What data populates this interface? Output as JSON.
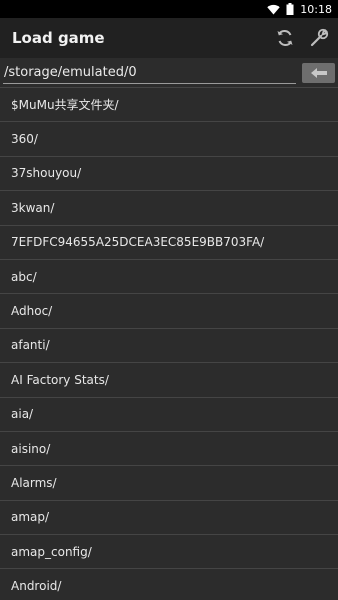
{
  "status_bar": {
    "time": "10:18"
  },
  "app_bar": {
    "title": "Load game"
  },
  "path_field": {
    "value": "/storage/emulated/0"
  },
  "files": [
    "$MuMu共享文件夹/",
    "360/",
    "37shouyou/",
    "3kwan/",
    "7EFDFC94655A25DCEA3EC85E9BB703FA/",
    "abc/",
    "Adhoc/",
    "afanti/",
    "AI Factory Stats/",
    "aia/",
    "aisino/",
    "Alarms/",
    "amap/",
    "amap_config/",
    "Android/"
  ],
  "icons": {
    "refresh": "refresh-icon",
    "settings": "wrench-icon",
    "back": "arrow-left-icon",
    "wifi": "wifi-icon",
    "battery": "battery-icon"
  }
}
